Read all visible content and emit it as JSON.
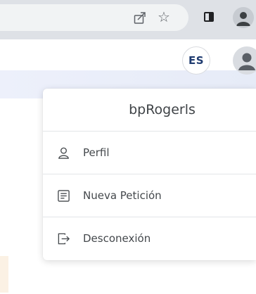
{
  "browser": {
    "toolbar_icons": [
      "share-icon",
      "star-icon",
      "side-panel-icon",
      "profile-icon"
    ],
    "star_glyph": "☆"
  },
  "header": {
    "language_code": "ES"
  },
  "user_menu": {
    "username": "bpRogerls",
    "items": [
      {
        "label": "Perfil",
        "icon": "person-icon"
      },
      {
        "label": "Nueva Petición",
        "icon": "document-icon"
      },
      {
        "label": "Desconexión",
        "icon": "logout-icon"
      }
    ]
  },
  "colors": {
    "accent_text": "#1f3b70",
    "menu_text": "#44484c",
    "divider": "#e3e5e8"
  }
}
